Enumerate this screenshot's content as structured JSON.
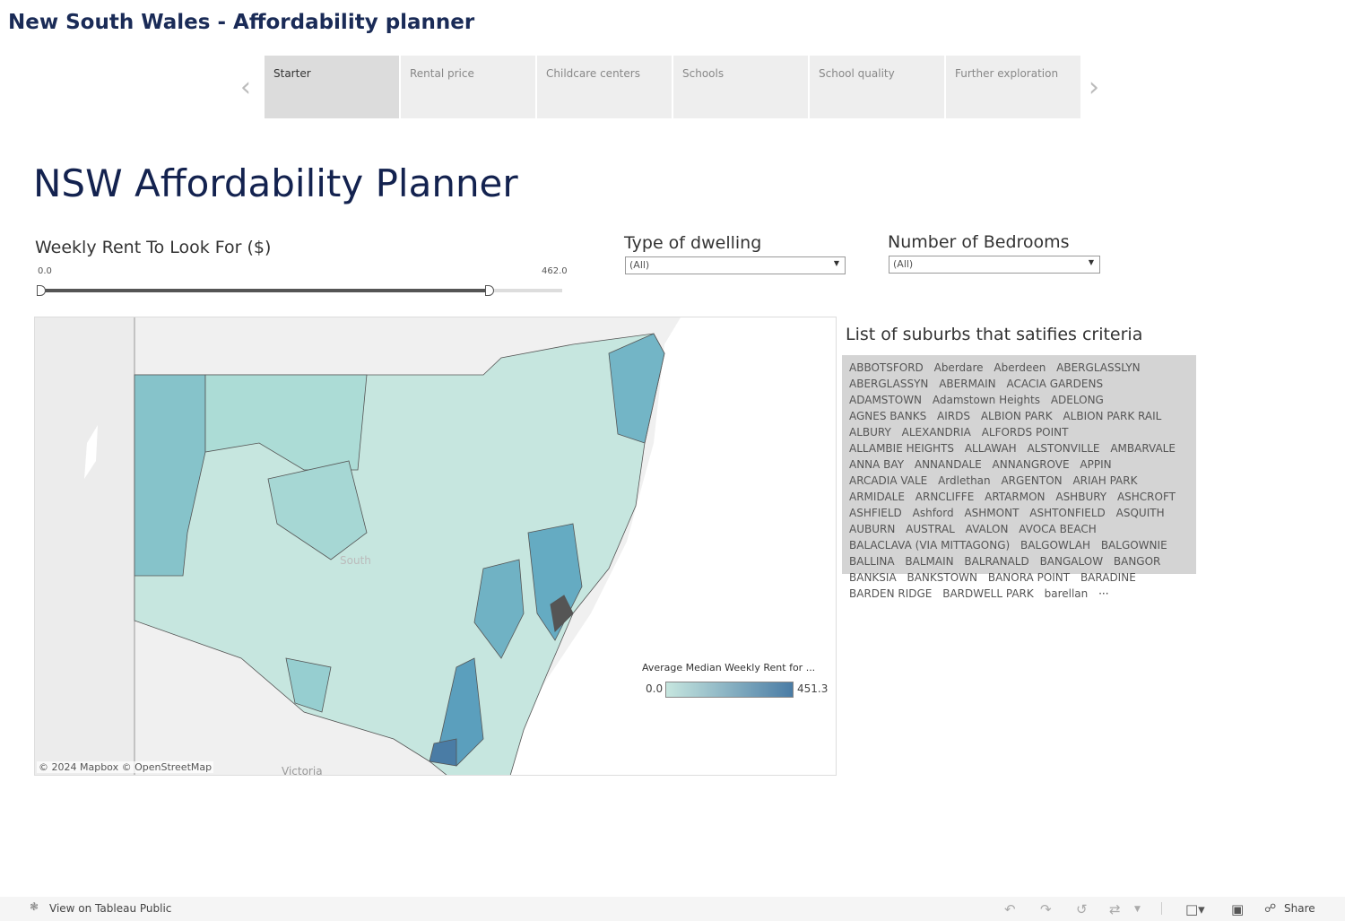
{
  "app_title": "New South Wales - Affordability planner",
  "tabs": [
    "Starter",
    "Rental price",
    "Childcare centers",
    "Schools",
    "School quality",
    "Further exploration"
  ],
  "active_tab": "Starter",
  "main_title": "NSW Affordability Planner",
  "rent_filter": {
    "label": "Weekly Rent To Look For ($)",
    "min": "0.0",
    "max": "462.0",
    "selected_fraction": 0.86
  },
  "dwelling_filter": {
    "label": "Type of dwelling",
    "value": "(All)"
  },
  "bedrooms_filter": {
    "label": "Number of Bedrooms",
    "value": "(All)"
  },
  "map": {
    "attribution": "© 2024 Mapbox  © OpenStreetMap",
    "labels": [
      "South",
      "Victoria"
    ],
    "legend": {
      "title": "Average Median Weekly Rent for ...",
      "min": "0.0",
      "max": "451.3",
      "color_low": "#c6e6df",
      "color_high": "#4a7ca5"
    }
  },
  "suburbs": {
    "title": "List of suburbs that satifies criteria",
    "items": [
      "ABBOTSFORD",
      "Aberdare",
      "Aberdeen",
      "ABERGLASSLYN",
      "ABERGLASSYN",
      "ABERMAIN",
      "ACACIA GARDENS",
      "ADAMSTOWN",
      "Adamstown Heights",
      "ADELONG",
      "AGNES BANKS",
      "AIRDS",
      "ALBION PARK",
      "ALBION PARK RAIL",
      "ALBURY",
      "ALEXANDRIA",
      "ALFORDS POINT",
      "ALLAMBIE HEIGHTS",
      "ALLAWAH",
      "ALSTONVILLE",
      "AMBARVALE",
      "ANNA BAY",
      "ANNANDALE",
      "ANNANGROVE",
      "APPIN",
      "ARCADIA VALE",
      "Ardlethan",
      "ARGENTON",
      "ARIAH PARK",
      "ARMIDALE",
      "ARNCLIFFE",
      "ARTARMON",
      "ASHBURY",
      "ASHCROFT",
      "ASHFIELD",
      "Ashford",
      "ASHMONT",
      "ASHTONFIELD",
      "ASQUITH",
      "AUBURN",
      "AUSTRAL",
      "AVALON",
      "AVOCA BEACH",
      "BALACLAVA (VIA MITTAGONG)",
      "BALGOWLAH",
      "BALGOWNIE",
      "BALLINA",
      "BALMAIN",
      "BALRANALD",
      "BANGALOW",
      "BANGOR",
      "BANKSIA",
      "BANKSTOWN",
      "BANORA POINT",
      "BARADINE",
      "BARDEN RIDGE",
      "BARDWELL PARK",
      "barellan"
    ],
    "more": "···"
  },
  "footer": {
    "view_label": "View on Tableau Public",
    "share_label": "Share"
  }
}
